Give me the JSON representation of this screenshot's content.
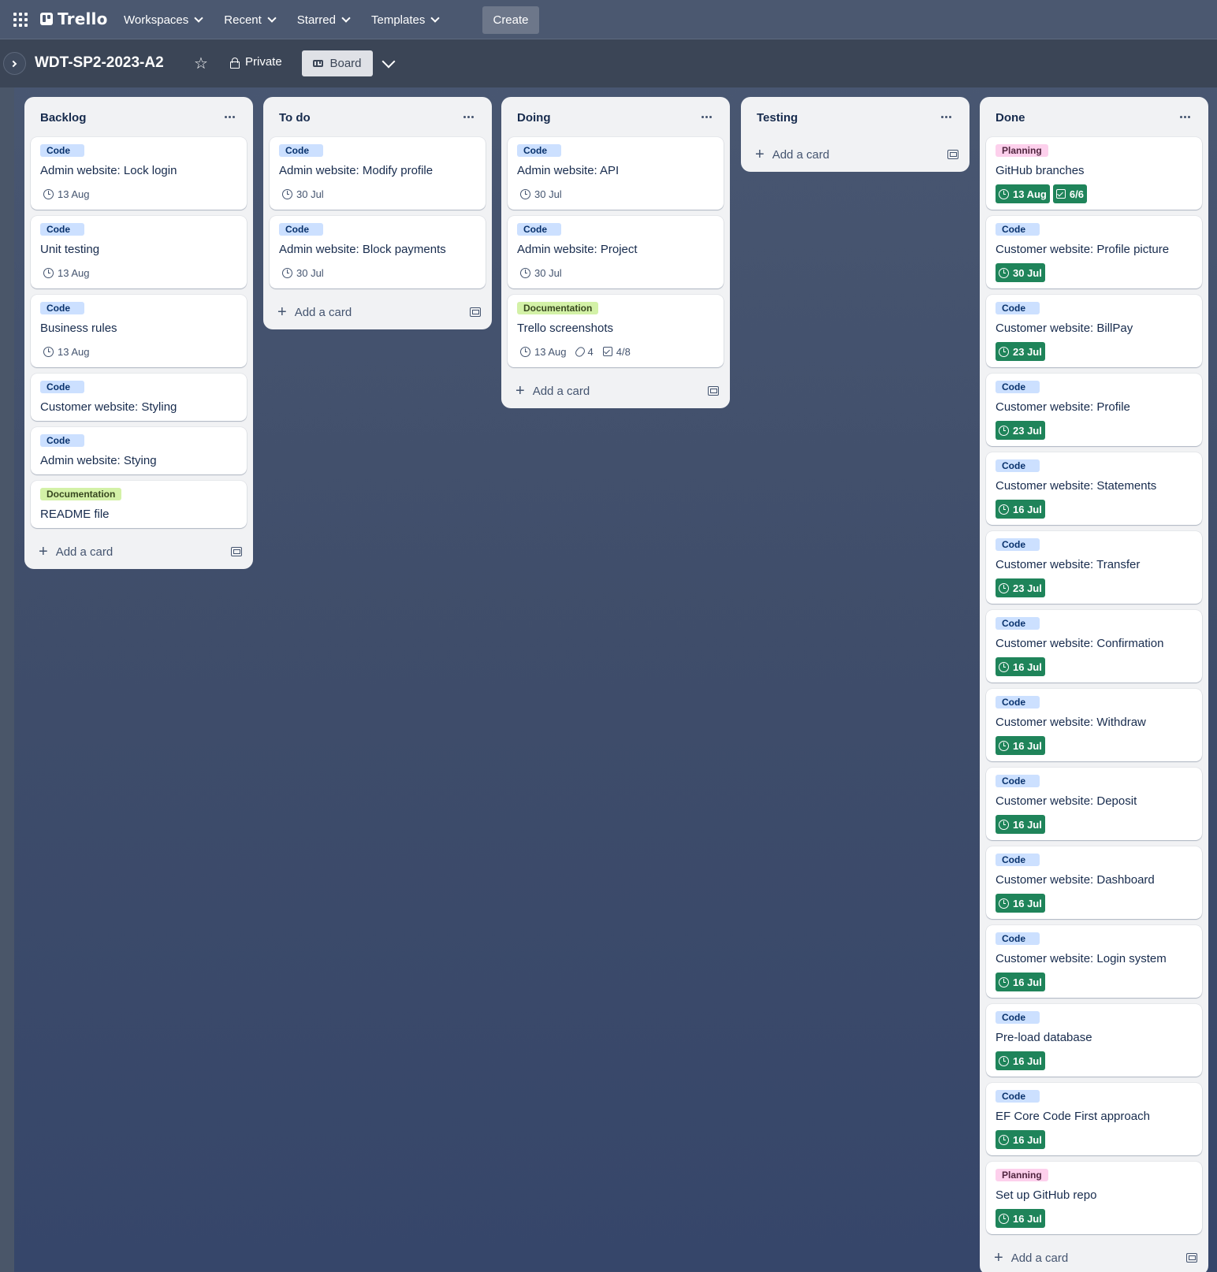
{
  "nav": {
    "app_name": "Trello",
    "menus": [
      "Workspaces",
      "Recent",
      "Starred",
      "Templates"
    ],
    "create_label": "Create"
  },
  "board": {
    "title": "WDT-SP2-2023-A2",
    "visibility": "Private",
    "view": "Board"
  },
  "add_card_label": "Add a card",
  "label_colors": {
    "Code": "#cce0ff",
    "Documentation": "#d3f1a7",
    "Planning": "#fdd0ec",
    "due_complete": "#1f845a"
  },
  "lists": [
    {
      "title": "Backlog",
      "cards": [
        {
          "label": "Code",
          "title": "Admin website: Lock login",
          "due": "13 Aug"
        },
        {
          "label": "Code",
          "title": "Unit testing",
          "due": "13 Aug"
        },
        {
          "label": "Code",
          "title": "Business rules",
          "due": "13 Aug"
        },
        {
          "label": "Code",
          "title": "Customer website: Styling"
        },
        {
          "label": "Code",
          "title": "Admin website: Stying"
        },
        {
          "label": "Documentation",
          "title": "README file"
        }
      ]
    },
    {
      "title": "To do",
      "cards": [
        {
          "label": "Code",
          "title": "Admin website: Modify profile",
          "due": "30 Jul"
        },
        {
          "label": "Code",
          "title": "Admin website: Block payments",
          "due": "30 Jul"
        }
      ]
    },
    {
      "title": "Doing",
      "cards": [
        {
          "label": "Code",
          "title": "Admin website: API",
          "due": "30 Jul"
        },
        {
          "label": "Code",
          "title": "Admin website: Project",
          "due": "30 Jul"
        },
        {
          "label": "Documentation",
          "title": "Trello screenshots",
          "due": "13 Aug",
          "attachments": "4",
          "checklist": "4/8"
        }
      ]
    },
    {
      "title": "Testing",
      "cards": []
    },
    {
      "title": "Done",
      "cards": [
        {
          "label": "Planning",
          "title": "GitHub branches",
          "due": "13 Aug",
          "due_complete": true,
          "checklist": "6/6",
          "checklist_complete": true
        },
        {
          "label": "Code",
          "title": "Customer website: Profile picture",
          "due": "30 Jul",
          "due_complete": true
        },
        {
          "label": "Code",
          "title": "Customer website: BillPay",
          "due": "23 Jul",
          "due_complete": true
        },
        {
          "label": "Code",
          "title": "Customer website: Profile",
          "due": "23 Jul",
          "due_complete": true
        },
        {
          "label": "Code",
          "title": "Customer website: Statements",
          "due": "16 Jul",
          "due_complete": true
        },
        {
          "label": "Code",
          "title": "Customer website: Transfer",
          "due": "23 Jul",
          "due_complete": true
        },
        {
          "label": "Code",
          "title": "Customer website: Confirmation",
          "due": "16 Jul",
          "due_complete": true
        },
        {
          "label": "Code",
          "title": "Customer website: Withdraw",
          "due": "16 Jul",
          "due_complete": true
        },
        {
          "label": "Code",
          "title": "Customer website: Deposit",
          "due": "16 Jul",
          "due_complete": true
        },
        {
          "label": "Code",
          "title": "Customer website: Dashboard",
          "due": "16 Jul",
          "due_complete": true
        },
        {
          "label": "Code",
          "title": "Customer website: Login system",
          "due": "16 Jul",
          "due_complete": true
        },
        {
          "label": "Code",
          "title": "Pre-load database",
          "due": "16 Jul",
          "due_complete": true
        },
        {
          "label": "Code",
          "title": "EF Core Code First approach",
          "due": "16 Jul",
          "due_complete": true
        },
        {
          "label": "Planning",
          "title": "Set up GitHub repo",
          "due": "16 Jul",
          "due_complete": true
        }
      ]
    }
  ]
}
